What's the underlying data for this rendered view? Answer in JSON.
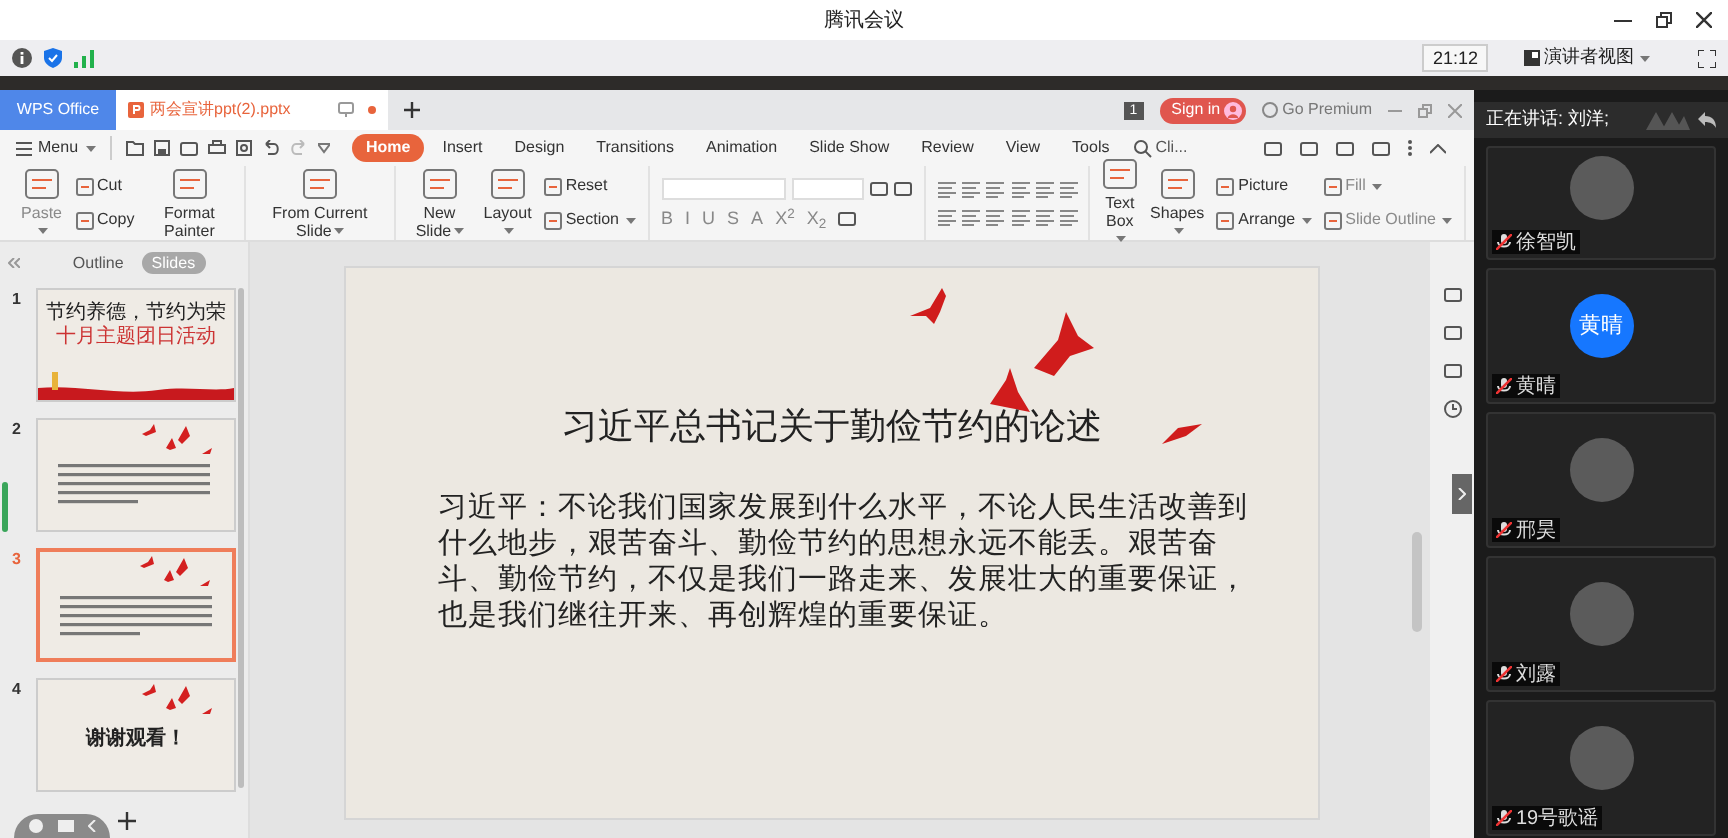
{
  "window": {
    "title": "腾讯会议"
  },
  "meeting_bar": {
    "time": "21:12",
    "view": "演讲者视图"
  },
  "wps": {
    "app_tab": "WPS Office",
    "document_tab": {
      "name": "两会宣讲ppt(2).pptx",
      "unsaved": true
    },
    "window_count": "1",
    "sign_in": "Sign in",
    "premium": "Go Premium",
    "menu": "Menu",
    "ribbon_tabs": [
      {
        "label": "Home",
        "selected": true
      },
      {
        "label": "Insert",
        "selected": false
      },
      {
        "label": "Design",
        "selected": false
      },
      {
        "label": "Transitions",
        "selected": false
      },
      {
        "label": "Animation",
        "selected": false
      },
      {
        "label": "Slide Show",
        "selected": false
      },
      {
        "label": "Review",
        "selected": false
      },
      {
        "label": "View",
        "selected": false
      },
      {
        "label": "Tools",
        "selected": false
      }
    ],
    "search": "Cli...",
    "ribbon_groups": [
      {
        "items": [
          {
            "label": "Paste",
            "kind": "large",
            "disabled": true,
            "dropdown": true
          },
          {
            "label": "Cut",
            "kind": "small",
            "disabled": false,
            "dropdown": false
          },
          {
            "label": "Copy",
            "kind": "small",
            "disabled": false,
            "dropdown": false
          },
          {
            "label": "Format Painter",
            "kind": "large",
            "disabled": false,
            "dropdown": false
          }
        ]
      },
      {
        "items": [
          {
            "label": "From Current Slide",
            "kind": "large",
            "disabled": false,
            "dropdown": true
          }
        ]
      },
      {
        "items": [
          {
            "label": "New Slide",
            "kind": "large",
            "disabled": false,
            "dropdown": true
          },
          {
            "label": "Layout",
            "kind": "large",
            "disabled": false,
            "dropdown": true
          },
          {
            "label": "Reset",
            "kind": "small",
            "disabled": false,
            "dropdown": false
          },
          {
            "label": "Section",
            "kind": "small",
            "disabled": false,
            "dropdown": true
          }
        ]
      },
      {
        "kind": "font"
      },
      {
        "kind": "paragraph"
      },
      {
        "items": [
          {
            "label": "Text Box",
            "kind": "large",
            "disabled": false,
            "dropdown": true
          },
          {
            "label": "Shapes",
            "kind": "large",
            "disabled": false,
            "dropdown": true
          },
          {
            "label": "Picture",
            "kind": "small",
            "disabled": false,
            "dropdown": false
          },
          {
            "label": "Arrange",
            "kind": "small",
            "disabled": false,
            "dropdown": true
          },
          {
            "label": "Fill",
            "kind": "small",
            "disabled": true,
            "dropdown": true
          },
          {
            "label": "Slide Outline",
            "kind": "small",
            "disabled": true,
            "dropdown": true
          }
        ]
      }
    ],
    "format_buttons": [
      "B",
      "I",
      "U",
      "S",
      "A",
      "X$^{2}$",
      "X$_{2}$"
    ],
    "pane_tabs": [
      {
        "label": "Outline",
        "selected": false
      },
      {
        "label": "Slides",
        "selected": true
      }
    ],
    "slides": [
      {
        "number": "1",
        "selected": false,
        "kind": "cover",
        "title": "节约养德，节约为荣",
        "subtitle": "十月主题团日活动"
      },
      {
        "number": "2",
        "selected": false,
        "kind": "text"
      },
      {
        "number": "3",
        "selected": true,
        "kind": "text"
      },
      {
        "number": "4",
        "selected": false,
        "kind": "ending",
        "title": "谢谢观看！"
      }
    ],
    "current_slide": {
      "title": "习近平总书记关于勤俭节约的论述",
      "body": "习近平：不论我们国家发展到什么水平，不论人民生活改善到什么地步，艰苦奋斗、勤俭节约的思想永远不能丢。艰苦奋斗、勤俭节约，不仅是我们一路走来、发展壮大的重要保证，也是我们继往开来、再创辉煌的重要保证。"
    }
  },
  "panel": {
    "speaking": "正在讲话: 刘洋;",
    "participants": [
      {
        "name": "徐智凯",
        "kind": "photo",
        "muted": true
      },
      {
        "name": "黄晴",
        "kind": "initials",
        "initials": "黄晴",
        "muted": true
      },
      {
        "name": "邢昊",
        "kind": "photo",
        "muted": true
      },
      {
        "name": "刘露",
        "kind": "photo",
        "muted": true
      },
      {
        "name": "19号歌谣",
        "kind": "photo",
        "muted": true
      }
    ]
  }
}
